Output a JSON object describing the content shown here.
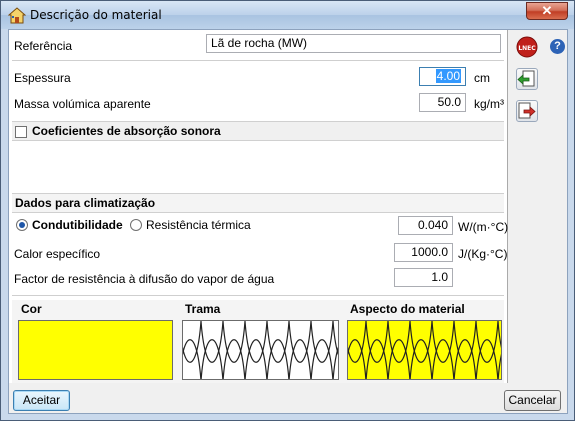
{
  "window": {
    "title": "Descrição do material",
    "close_label": "✕"
  },
  "fields": {
    "referencia_label": "Referência",
    "referencia_value": "Lã de rocha (MW)",
    "espessura_label": "Espessura",
    "espessura_value": "4.00",
    "espessura_unit": "cm",
    "massa_label": "Massa volúmica aparente",
    "massa_value": "50.0",
    "massa_unit": "kg/m³"
  },
  "sound": {
    "checkbox_label": "Coeficientes de absorção sonora"
  },
  "climate": {
    "title": "Dados para climatização",
    "radio_cond": "Condutibilidade",
    "radio_res": "Resistência térmica",
    "cond_value": "0.040",
    "cond_unit": "W/(m·°C)",
    "calor_label": "Calor específico",
    "calor_value": "1000.0",
    "calor_unit": "J/(Kg·°C)",
    "factor_label": "Factor de resistência à difusão do vapor de água",
    "factor_value": "1.0"
  },
  "appearance": {
    "cor_label": "Cor",
    "trama_label": "Trama",
    "aspecto_label": "Aspecto do material",
    "cor_color": "#ffff00",
    "aspecto_color": "#ffff00"
  },
  "sidebar": {
    "lnec_label": "LNEC",
    "help_label": "?",
    "import_icon": "import-arrow-icon",
    "export_icon": "export-arrow-icon"
  },
  "buttons": {
    "accept": "Aceitar",
    "cancel": "Cancelar"
  }
}
